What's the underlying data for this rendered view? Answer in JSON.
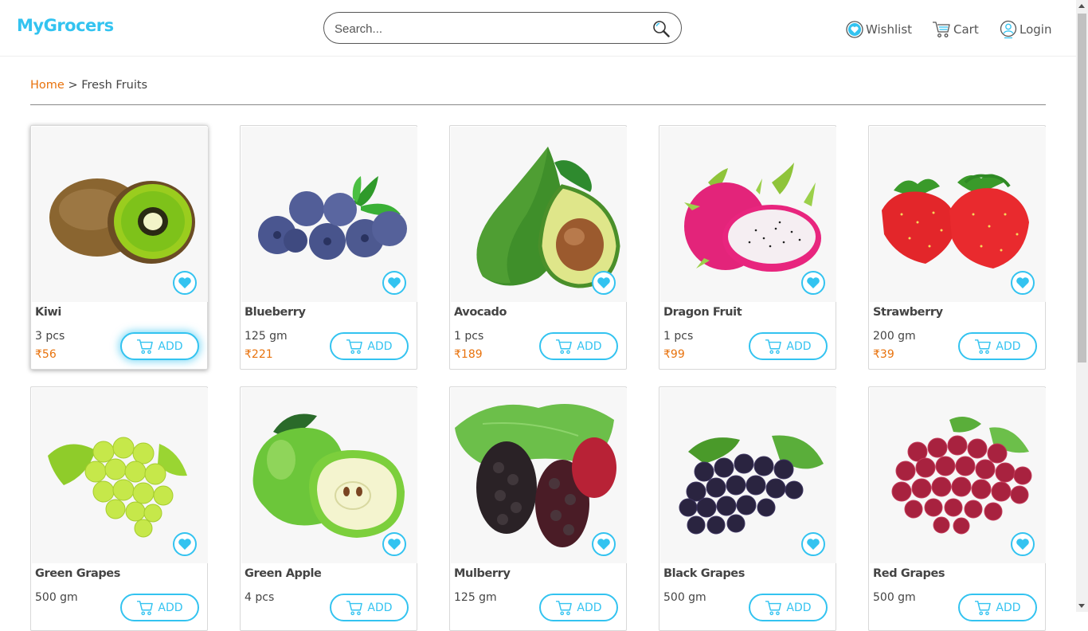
{
  "app": {
    "logo": "MyGrocers",
    "accent_color": "#33c3f0",
    "price_color": "#e8720c"
  },
  "search": {
    "placeholder": "Search...",
    "value": ""
  },
  "nav": {
    "wishlist": "Wishlist",
    "cart": "Cart",
    "login": "Login"
  },
  "breadcrumb": {
    "home": "Home",
    "separator": ">",
    "current": "Fresh Fruits"
  },
  "products": [
    {
      "name": "Kiwi",
      "qty": "3 pcs",
      "price": "₹56",
      "add_label": "ADD",
      "icon": "kiwi"
    },
    {
      "name": "Blueberry",
      "qty": "125 gm",
      "price": "₹221",
      "add_label": "ADD",
      "icon": "blueberry"
    },
    {
      "name": "Avocado",
      "qty": "1 pcs",
      "price": "₹189",
      "add_label": "ADD",
      "icon": "avocado"
    },
    {
      "name": "Dragon Fruit",
      "qty": "1 pcs",
      "price": "₹99",
      "add_label": "ADD",
      "icon": "dragon-fruit"
    },
    {
      "name": "Strawberry",
      "qty": "200 gm",
      "price": "₹39",
      "add_label": "ADD",
      "icon": "strawberry"
    },
    {
      "name": "Green Grapes",
      "qty": "500 gm",
      "price": "",
      "add_label": "ADD",
      "icon": "green-grapes"
    },
    {
      "name": "Green Apple",
      "qty": "4 pcs",
      "price": "",
      "add_label": "ADD",
      "icon": "green-apple"
    },
    {
      "name": "Mulberry",
      "qty": "125 gm",
      "price": "",
      "add_label": "ADD",
      "icon": "mulberry"
    },
    {
      "name": "Black Grapes",
      "qty": "500 gm",
      "price": "",
      "add_label": "ADD",
      "icon": "black-grapes"
    },
    {
      "name": "Red Grapes",
      "qty": "500 gm",
      "price": "",
      "add_label": "ADD",
      "icon": "red-grapes"
    }
  ]
}
